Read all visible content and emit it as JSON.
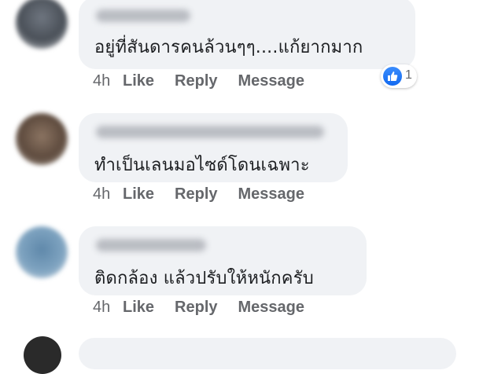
{
  "comments": [
    {
      "text": "อยู่ที่สันดารคนล้วนๆๆ....แก้ยากมาก",
      "time": "4h",
      "like_label": "Like",
      "reply_label": "Reply",
      "message_label": "Message",
      "reaction_count": "1",
      "reaction_icon": "like-icon"
    },
    {
      "text": "ทำเป็นเลนมอไซด์โดนเฉพาะ",
      "time": "4h",
      "like_label": "Like",
      "reply_label": "Reply",
      "message_label": "Message"
    },
    {
      "text": "ติดกล้อง แล้วปรับให้หนักครับ",
      "time": "4h",
      "like_label": "Like",
      "reply_label": "Reply",
      "message_label": "Message"
    }
  ],
  "colors": {
    "bubble": "#f0f2f5",
    "action_text": "#65676b",
    "like_blue": "#1877f2"
  }
}
